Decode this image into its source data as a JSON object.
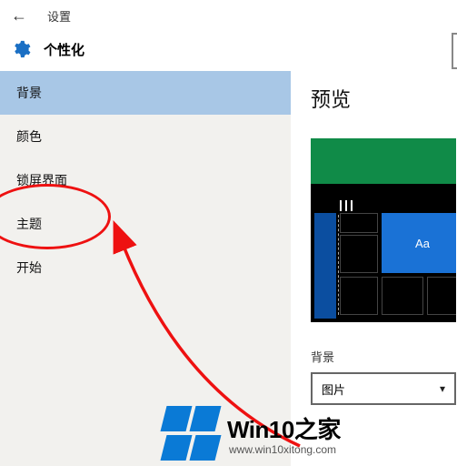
{
  "topbar": {
    "title": "设置"
  },
  "header": {
    "title": "个性化"
  },
  "sidebar": {
    "items": [
      {
        "label": "背景",
        "active": true
      },
      {
        "label": "颜色"
      },
      {
        "label": "锁屏界面"
      },
      {
        "label": "主题"
      },
      {
        "label": "开始"
      }
    ]
  },
  "content": {
    "preview_title": "预览",
    "tile_aa": "Aa",
    "bg_label": "背景",
    "bg_dropdown": {
      "value": "图片"
    }
  },
  "watermark": {
    "main": "Win10之家",
    "sub": "www.win10xitong.com"
  }
}
